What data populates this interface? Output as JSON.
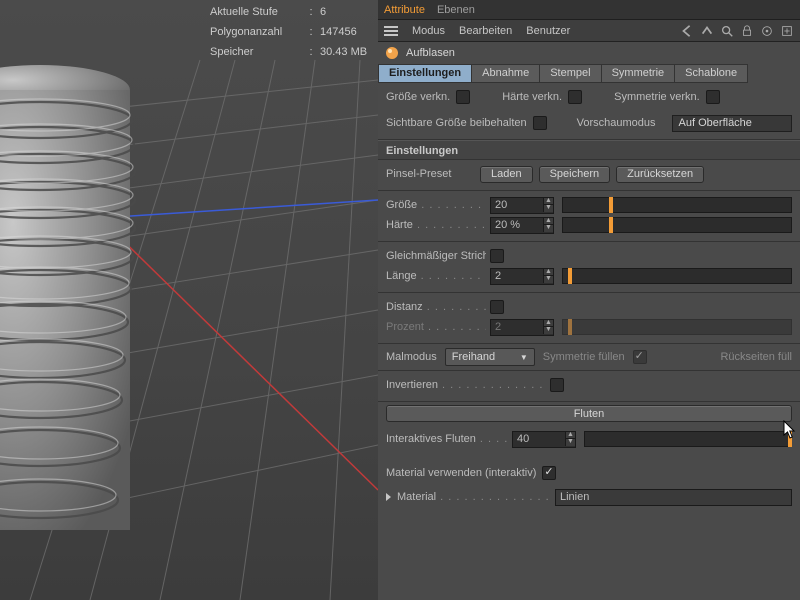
{
  "viewport": {
    "stats": {
      "stage_label": "Aktuelle Stufe",
      "stage_value": "6",
      "polys_label": "Polygonanzahl",
      "polys_value": "147456",
      "mem_label": "Speicher",
      "mem_value": "30.43 MB"
    }
  },
  "panel": {
    "tabs_top": {
      "attribute": "Attribute",
      "ebenen": "Ebenen"
    },
    "menu": {
      "modus": "Modus",
      "bearbeiten": "Bearbeiten",
      "benutzer": "Benutzer"
    },
    "object_title": "Aufblasen",
    "subtabs": {
      "einstellungen": "Einstellungen",
      "abnahme": "Abnahme",
      "stempel": "Stempel",
      "symmetrie": "Symmetrie",
      "schablone": "Schablone"
    },
    "options": {
      "groesse_verkn": "Größe verkn.",
      "haerte_verkn": "Härte verkn.",
      "symmetrie_verkn": "Symmetrie verkn.",
      "sichtbare_groesse": "Sichtbare Größe beibehalten",
      "vorschaumodus": "Vorschaumodus",
      "vorschaumodus_value": "Auf Oberfläche"
    },
    "settings_header": "Einstellungen",
    "pinsel_preset": {
      "label": "Pinsel-Preset",
      "load": "Laden",
      "save": "Speichern",
      "reset": "Zurücksetzen"
    },
    "groesse": {
      "label": "Größe",
      "value": "20",
      "pct": 20
    },
    "haerte": {
      "label": "Härte",
      "value": "20 %",
      "pct": 20
    },
    "strich": {
      "label": "Gleichmäßiger Strich"
    },
    "laenge": {
      "label": "Länge",
      "value": "2",
      "pct": 2
    },
    "distanz": {
      "label": "Distanz"
    },
    "prozent": {
      "label": "Prozent",
      "value": "2",
      "pct": 2
    },
    "malmodus": {
      "label": "Malmodus",
      "value": "Freihand",
      "sym_fill": "Symmetrie füllen",
      "rueckseiten": "Rückseiten füll"
    },
    "invertieren": {
      "label": "Invertieren"
    },
    "fluten_btn": "Fluten",
    "interaktives_fluten": {
      "label": "Interaktives Fluten",
      "value": "40",
      "pct": 100
    },
    "material_verwenden": "Material verwenden (interaktiv)",
    "material": {
      "label": "Material",
      "value": "Linien"
    }
  }
}
